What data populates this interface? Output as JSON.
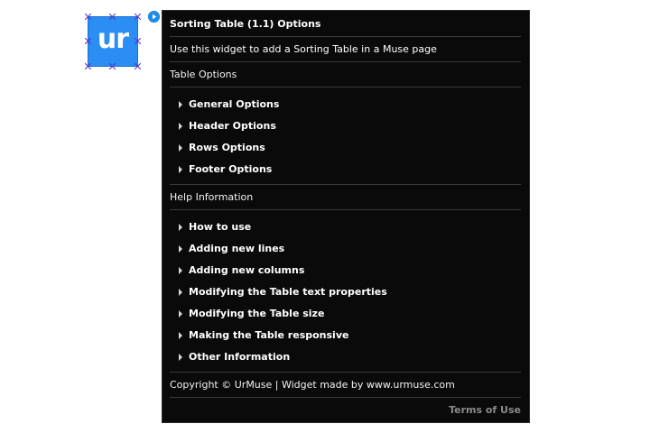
{
  "widget": {
    "thumb_text": "ur",
    "thumb_color": "#2b8ef3"
  },
  "panel": {
    "title": "Sorting Table (1.1) Options",
    "description": "Use this widget to add a Sorting Table in a Muse page",
    "table_options_label": "Table Options",
    "table_options": [
      {
        "label": "General Options"
      },
      {
        "label": "Header Options"
      },
      {
        "label": "Rows Options"
      },
      {
        "label": "Footer Options"
      }
    ],
    "help_label": "Help Information",
    "help_items": [
      {
        "label": "How to use"
      },
      {
        "label": "Adding new lines"
      },
      {
        "label": "Adding new columns"
      },
      {
        "label": "Modifying the Table text properties"
      },
      {
        "label": "Modifying the Table size"
      },
      {
        "label": "Making the Table responsive"
      },
      {
        "label": "Other Information"
      }
    ],
    "copyright": "Copyright © UrMuse | Widget made by www.urmuse.com",
    "terms_label": "Terms of Use"
  },
  "colors": {
    "panel_background": "#0a0a0a",
    "badge_blue": "#1e8be6",
    "muted_text": "#8a8a8a"
  },
  "icons": {
    "badge": "play-circle-icon",
    "expander": "triangle-right-icon",
    "handle": "cross-handle-icon"
  }
}
